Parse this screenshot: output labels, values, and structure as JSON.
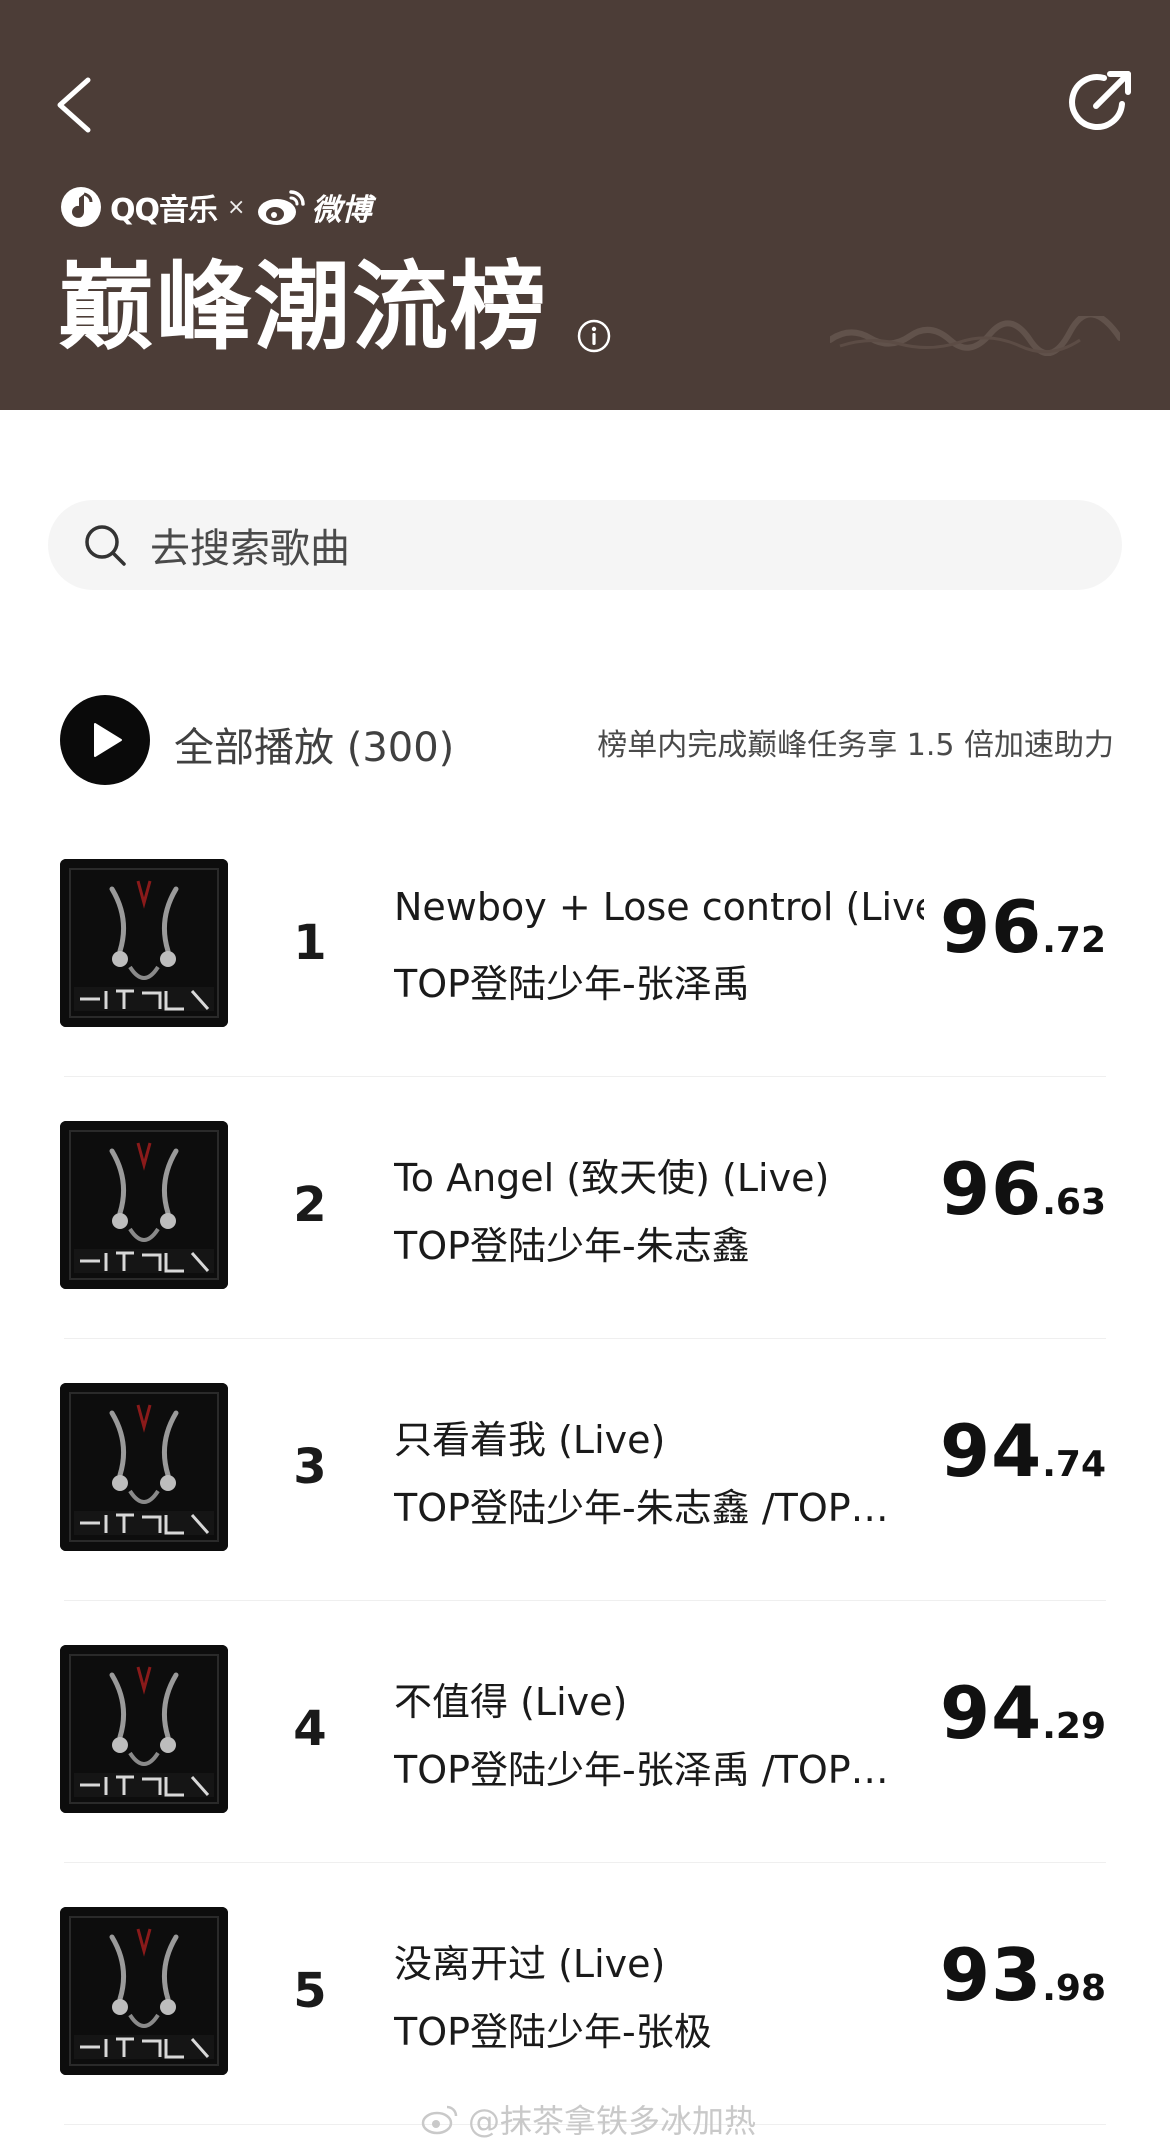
{
  "header": {
    "brand_qq": "QQ音乐",
    "brand_cross": "×",
    "brand_weibo": "微博",
    "title": "巅峰潮流榜",
    "back_icon": "chevron-left-icon",
    "share_icon": "share-arrow-icon",
    "info_icon": "info-icon",
    "background_color": "#4c3d37"
  },
  "search": {
    "placeholder": "去搜索歌曲",
    "icon": "search-icon"
  },
  "play_all": {
    "label": "全部播放 (300)",
    "note": "榜单内完成巅峰任务享 1.5 倍加速助力",
    "icon": "play-icon"
  },
  "songs": [
    {
      "rank": "1",
      "title": "Newboy + Lose control (Live)",
      "artist": "TOP登陆少年-张泽禹",
      "score_int": "96",
      "score_dec": ".72"
    },
    {
      "rank": "2",
      "title": "To Angel (致天使) (Live)",
      "artist": "TOP登陆少年-朱志鑫",
      "score_int": "96",
      "score_dec": ".63"
    },
    {
      "rank": "3",
      "title": "只看着我 (Live)",
      "artist": "TOP登陆少年-朱志鑫 /TOP…",
      "score_int": "94",
      "score_dec": ".74"
    },
    {
      "rank": "4",
      "title": "不值得 (Live)",
      "artist": "TOP登陆少年-张泽禹 /TOP…",
      "score_int": "94",
      "score_dec": ".29"
    },
    {
      "rank": "5",
      "title": "没离开过 (Live)",
      "artist": "TOP登陆少年-张极",
      "score_int": "93",
      "score_dec": ".98"
    }
  ],
  "watermark": "@抹茶拿铁多冰加热"
}
